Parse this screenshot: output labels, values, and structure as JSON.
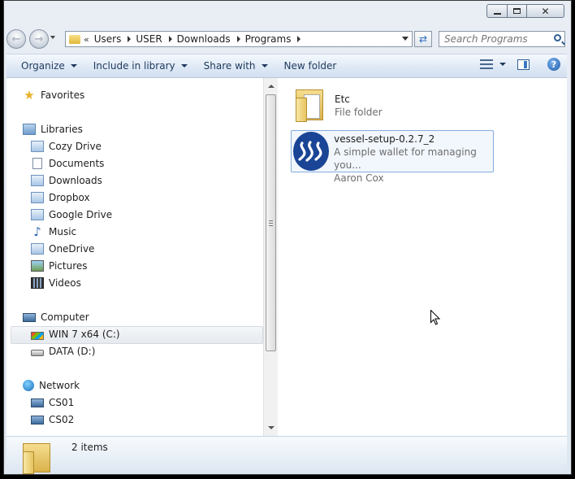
{
  "window": {
    "caption": {
      "minimize": "",
      "maximize": "",
      "close": "✕"
    }
  },
  "address": {
    "chevrons": "«",
    "crumbs": [
      "Users",
      "USER",
      "Downloads",
      "Programs"
    ]
  },
  "search": {
    "placeholder": "Search Programs"
  },
  "toolbar": {
    "organize": "Organize",
    "include_in_library": "Include in library",
    "share_with": "Share with",
    "new_folder": "New folder",
    "help": "?"
  },
  "nav": {
    "favorites": "Favorites",
    "libraries": "Libraries",
    "library_items": [
      "Cozy Drive",
      "Documents",
      "Downloads",
      "Dropbox",
      "Google Drive",
      "Music",
      "OneDrive",
      "Pictures",
      "Videos"
    ],
    "computer": "Computer",
    "drives": [
      "WIN 7 x64 (C:)",
      "DATA (D:)"
    ],
    "network": "Network",
    "network_items": [
      "CS01",
      "CS02"
    ]
  },
  "files": [
    {
      "name": "Etc",
      "sub1": "File folder",
      "sub2": ""
    },
    {
      "name": "vessel-setup-0.2.7_2",
      "sub1": "A simple wallet for managing you...",
      "sub2": "Aaron Cox"
    }
  ],
  "status": {
    "count": "2 items"
  },
  "colors": {
    "steem_blue": "#1a4596",
    "toolbar_text": "#1e395b",
    "selection_border": "#84acdd"
  }
}
